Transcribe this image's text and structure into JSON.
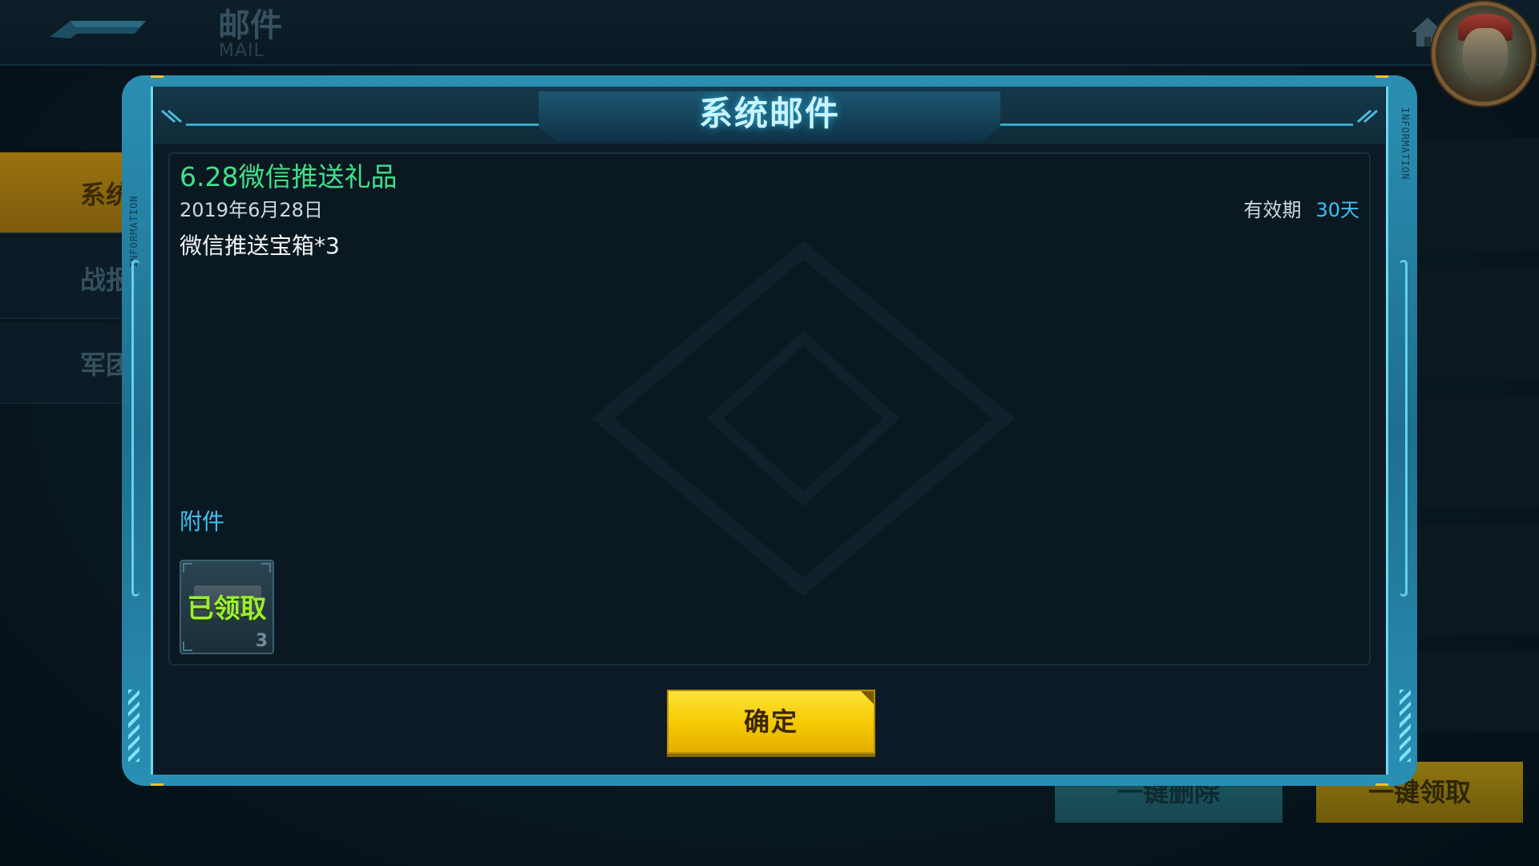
{
  "background": {
    "title": "邮件",
    "subtitle": "MAIL",
    "side_tabs": [
      "系统",
      "战报",
      "军团"
    ],
    "buttons": {
      "delete_all": "一键删除",
      "claim_all": "一键领取"
    }
  },
  "dialog": {
    "title": "系统邮件",
    "side_label": "INFORMATION",
    "mail": {
      "subject": "6.28微信推送礼品",
      "date": "2019年6月28日",
      "validity_label": "有效期",
      "validity_value": "30天",
      "body": "微信推送宝箱*3"
    },
    "attachments_label": "附件",
    "attachment": {
      "status": "已领取",
      "quantity": "3"
    },
    "confirm_label": "确定"
  },
  "colors": {
    "accent_cyan": "#3cc3f4",
    "subject_green": "#41e08a",
    "claimed_green": "#9cf02e",
    "button_yellow": "#f4c800",
    "frame_blue": "#2b8fb2"
  },
  "icons": [
    "back-arrow-icon",
    "home-icon",
    "avatar-portrait",
    "treasure-chest-icon",
    "hash-ornament-icon"
  ]
}
